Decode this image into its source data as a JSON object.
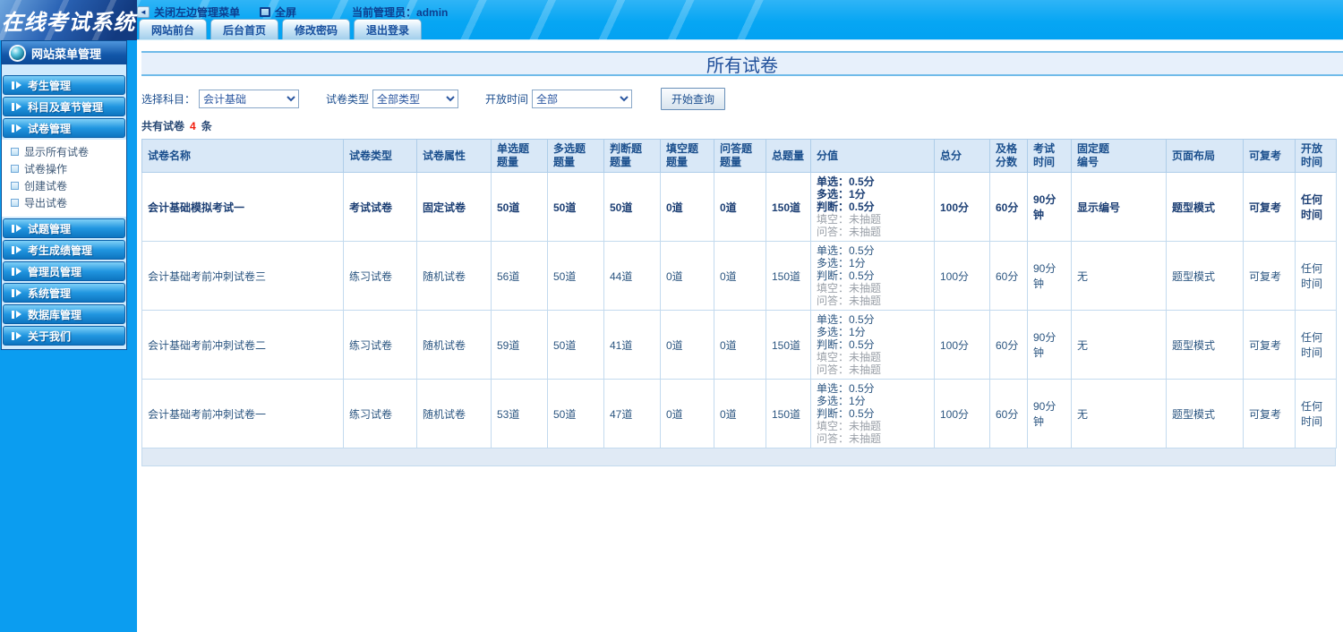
{
  "topbar": {
    "logo": "在线考试系统",
    "close_menu": "关闭左边管理菜单",
    "fullscreen": "全屏",
    "admin_label": "当前管理员：admin",
    "tabs": [
      "网站前台",
      "后台首页",
      "修改密码",
      "退出登录"
    ]
  },
  "sidebar": {
    "header": "网站菜单管理",
    "groups": [
      {
        "label": "考生管理",
        "items": []
      },
      {
        "label": "科目及章节管理",
        "items": []
      },
      {
        "label": "试卷管理",
        "items": [
          "显示所有试卷",
          "试卷操作",
          "创建试卷",
          "导出试卷"
        ]
      },
      {
        "label": "试题管理",
        "items": []
      },
      {
        "label": "考生成绩管理",
        "items": []
      },
      {
        "label": "管理员管理",
        "items": []
      },
      {
        "label": "系统管理",
        "items": []
      },
      {
        "label": "数据库管理",
        "items": []
      },
      {
        "label": "关于我们",
        "items": []
      }
    ]
  },
  "main": {
    "title": "所有试卷",
    "filters": {
      "subject_label": "选择科目：",
      "subject_value": "会计基础",
      "type_label": "试卷类型",
      "type_value": "全部类型",
      "time_label": "开放时间",
      "time_value": "全部",
      "search_button": "开始查询"
    },
    "count": {
      "prefix": "共有试卷",
      "value": "4",
      "suffix": "条"
    },
    "table": {
      "headers": [
        "试卷名称",
        "试卷类型",
        "试卷属性",
        [
          "单选题",
          "题量"
        ],
        [
          "多选题",
          "题量"
        ],
        [
          "判断题",
          "题量"
        ],
        [
          "填空题",
          "题量"
        ],
        [
          "问答题",
          "题量"
        ],
        "总题量",
        "分值",
        "总分",
        [
          "及格",
          "分数"
        ],
        [
          "考试",
          "时间"
        ],
        [
          "固定题",
          "编号"
        ],
        "页面布局",
        "可复考",
        "开放时间"
      ],
      "rows": [
        {
          "bold": true,
          "name": "会计基础模拟考试一",
          "type": "考试试卷",
          "attr": "固定试卷",
          "single": "50道",
          "multi": "50道",
          "judge": "50道",
          "blank": "0道",
          "qa": "0道",
          "total": "150道",
          "score_lines": [
            {
              "t": "单选：0.5分",
              "m": false
            },
            {
              "t": "多选：1分",
              "m": false
            },
            {
              "t": "判断：0.5分",
              "m": false
            },
            {
              "t": "填空：未抽题",
              "m": true
            },
            {
              "t": "问答：未抽题",
              "m": true
            }
          ],
          "total_score": "100分",
          "pass_score": "60分",
          "duration": "90分钟",
          "fixed_no": "显示编号",
          "layout": "题型模式",
          "retake": "可复考",
          "open_time": "任何时间"
        },
        {
          "bold": false,
          "name": "会计基础考前冲刺试卷三",
          "type": "练习试卷",
          "attr": "随机试卷",
          "single": "56道",
          "multi": "50道",
          "judge": "44道",
          "blank": "0道",
          "qa": "0道",
          "total": "150道",
          "score_lines": [
            {
              "t": "单选：0.5分",
              "m": false
            },
            {
              "t": "多选：1分",
              "m": false
            },
            {
              "t": "判断：0.5分",
              "m": false
            },
            {
              "t": "填空：未抽题",
              "m": true
            },
            {
              "t": "问答：未抽题",
              "m": true
            }
          ],
          "total_score": "100分",
          "pass_score": "60分",
          "duration": "90分钟",
          "fixed_no": "无",
          "layout": "题型模式",
          "retake": "可复考",
          "open_time": "任何时间"
        },
        {
          "bold": false,
          "name": "会计基础考前冲刺试卷二",
          "type": "练习试卷",
          "attr": "随机试卷",
          "single": "59道",
          "multi": "50道",
          "judge": "41道",
          "blank": "0道",
          "qa": "0道",
          "total": "150道",
          "score_lines": [
            {
              "t": "单选：0.5分",
              "m": false
            },
            {
              "t": "多选：1分",
              "m": false
            },
            {
              "t": "判断：0.5分",
              "m": false
            },
            {
              "t": "填空：未抽题",
              "m": true
            },
            {
              "t": "问答：未抽题",
              "m": true
            }
          ],
          "total_score": "100分",
          "pass_score": "60分",
          "duration": "90分钟",
          "fixed_no": "无",
          "layout": "题型模式",
          "retake": "可复考",
          "open_time": "任何时间"
        },
        {
          "bold": false,
          "name": "会计基础考前冲刺试卷一",
          "type": "练习试卷",
          "attr": "随机试卷",
          "single": "53道",
          "multi": "50道",
          "judge": "47道",
          "blank": "0道",
          "qa": "0道",
          "total": "150道",
          "score_lines": [
            {
              "t": "单选：0.5分",
              "m": false
            },
            {
              "t": "多选：1分",
              "m": false
            },
            {
              "t": "判断：0.5分",
              "m": false
            },
            {
              "t": "填空：未抽题",
              "m": true
            },
            {
              "t": "问答：未抽题",
              "m": true
            }
          ],
          "total_score": "100分",
          "pass_score": "60分",
          "duration": "90分钟",
          "fixed_no": "无",
          "layout": "题型模式",
          "retake": "可复考",
          "open_time": "任何时间"
        }
      ]
    }
  }
}
